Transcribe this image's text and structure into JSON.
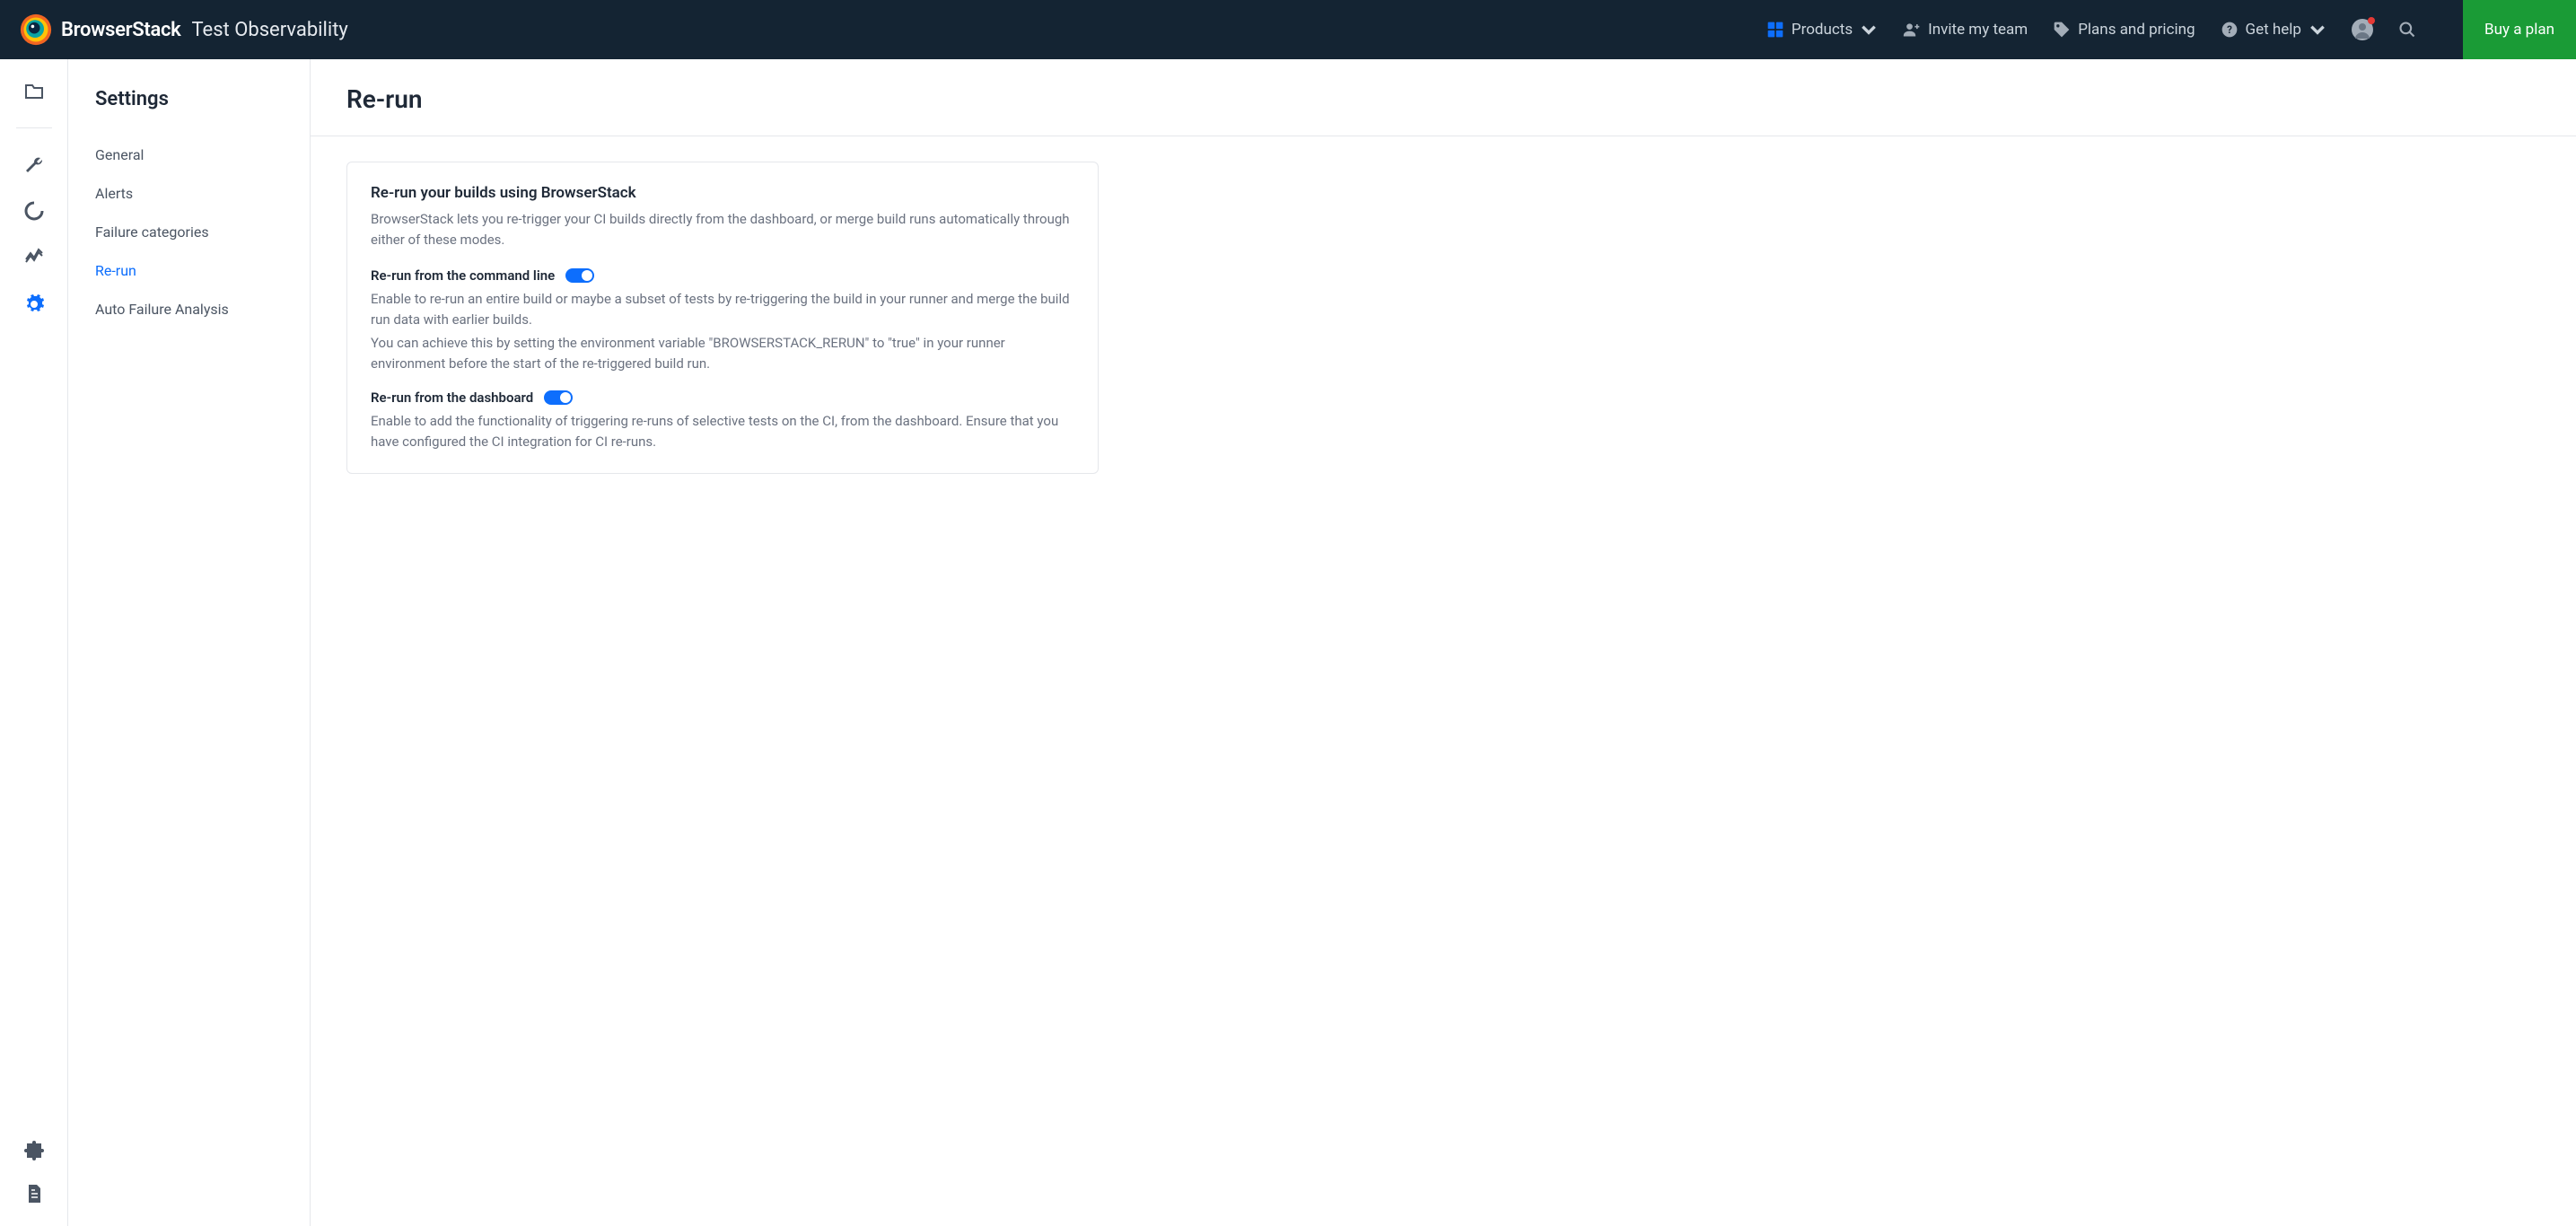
{
  "header": {
    "brand": "BrowserStack",
    "product": "Test Observability",
    "nav": {
      "products": "Products",
      "invite": "Invite my team",
      "plans": "Plans and pricing",
      "help": "Get help"
    },
    "buy": "Buy a plan"
  },
  "sidebar": {
    "title": "Settings",
    "items": [
      "General",
      "Alerts",
      "Failure categories",
      "Re-run",
      "Auto Failure Analysis"
    ],
    "active_index": 3
  },
  "page": {
    "title": "Re-run",
    "card": {
      "title": "Re-run your builds using BrowserStack",
      "desc": "BrowserStack lets you re-trigger your CI builds directly from the dashboard, or merge build runs automatically through either of these modes.",
      "settings": [
        {
          "label": "Re-run from the command line",
          "on": true,
          "desc1": "Enable to re-run an entire build or maybe a subset of tests by re-triggering the build in your runner and merge the build run data with earlier builds.",
          "desc2": "You can achieve this by setting the environment variable \"BROWSERSTACK_RERUN\" to \"true\" in your runner environment before the start of the re-triggered build run."
        },
        {
          "label": "Re-run from the dashboard",
          "on": true,
          "desc1": "Enable to add the functionality of triggering re-runs of selective tests on the CI, from the dashboard. Ensure that you have configured the CI integration for CI re-runs."
        }
      ]
    }
  }
}
